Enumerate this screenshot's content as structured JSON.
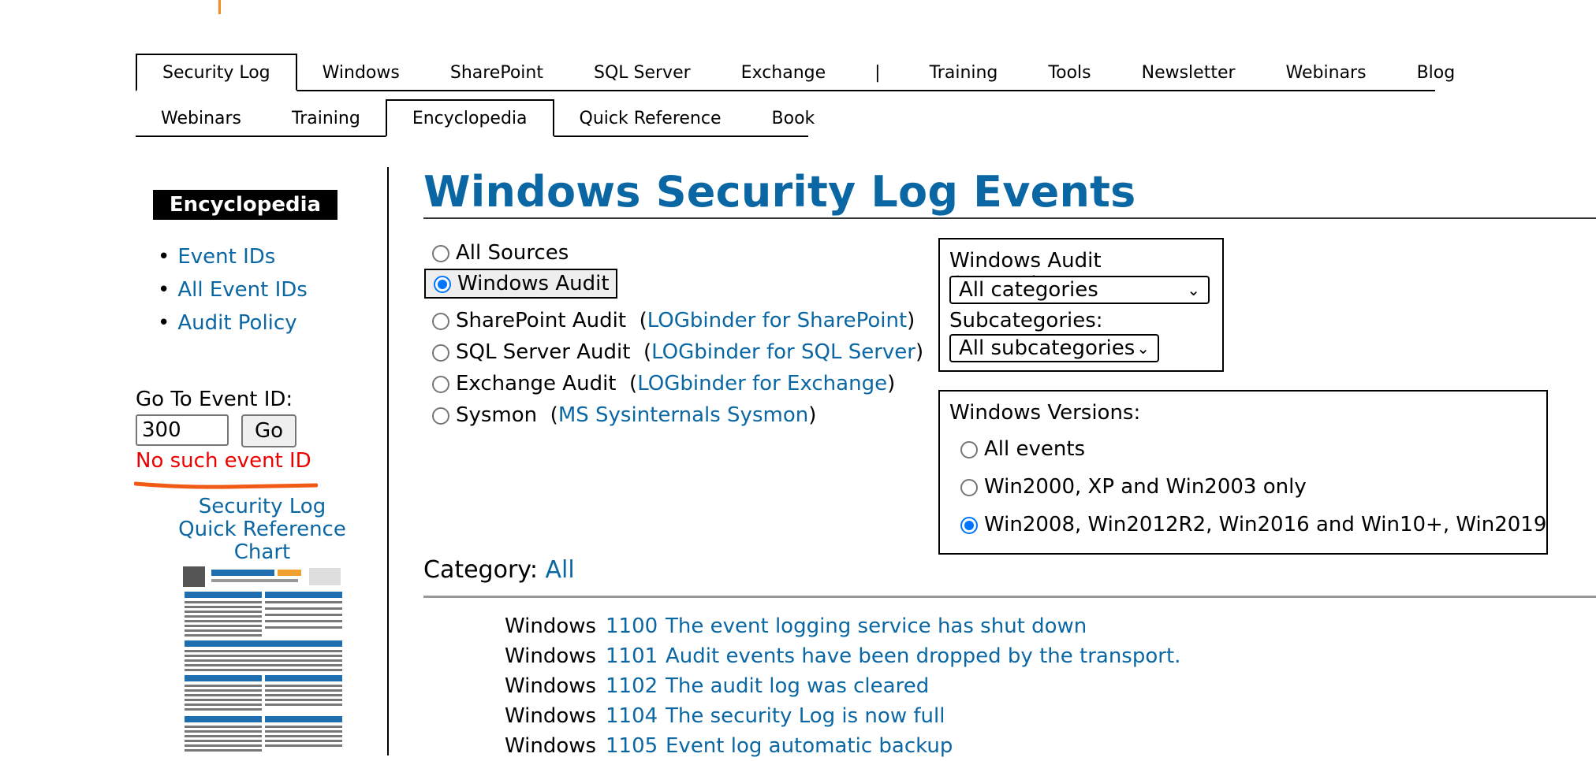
{
  "nav_primary": [
    "Security Log",
    "Windows",
    "SharePoint",
    "SQL Server",
    "Exchange",
    "|",
    "Training",
    "Tools",
    "Newsletter",
    "Webinars",
    "Blog"
  ],
  "nav_secondary": [
    "Webinars",
    "Training",
    "Encyclopedia",
    "Quick Reference",
    "Book"
  ],
  "sidebar": {
    "badge": "Encyclopedia",
    "links": [
      "Event IDs",
      "All Event IDs",
      "Audit Policy"
    ],
    "goto_label": "Go To Event ID:",
    "goto_value": "300",
    "go_button": "Go",
    "error": "No such event ID",
    "quickref": [
      "Security Log",
      "Quick Reference",
      "Chart"
    ]
  },
  "main": {
    "title": "Windows Security Log Events",
    "sources": [
      {
        "label": "All Sources",
        "link": "",
        "checked": false
      },
      {
        "label": "Windows Audit",
        "link": "",
        "checked": true
      },
      {
        "label": "SharePoint Audit",
        "link": "LOGbinder for SharePoint",
        "checked": false
      },
      {
        "label": "SQL Server Audit",
        "link": "LOGbinder for SQL Server",
        "checked": false
      },
      {
        "label": "Exchange Audit",
        "link": "LOGbinder for Exchange",
        "checked": false
      },
      {
        "label": "Sysmon",
        "link": "MS Sysinternals Sysmon",
        "checked": false
      }
    ],
    "categories_label": "Windows Audit Categories:",
    "categories_value": "All categories",
    "subcategories_label": "Subcategories:",
    "subcategories_value": "All subcategories",
    "versions_label": "Windows Versions:",
    "versions": [
      {
        "label": "All events",
        "checked": false
      },
      {
        "label": "Win2000, XP and Win2003 only",
        "checked": false
      },
      {
        "label": "Win2008, Win2012R2, Win2016 and Win10+, Win2019",
        "checked": true
      }
    ],
    "category_prefix": "Category:",
    "category_value": "All",
    "events": [
      {
        "source": "Windows",
        "id": "1100",
        "desc": "The event logging service has shut down"
      },
      {
        "source": "Windows",
        "id": "1101",
        "desc": "Audit events have been dropped by the transport."
      },
      {
        "source": "Windows",
        "id": "1102",
        "desc": "The audit log was cleared"
      },
      {
        "source": "Windows",
        "id": "1104",
        "desc": "The security Log is now full"
      },
      {
        "source": "Windows",
        "id": "1105",
        "desc": "Event log automatic backup"
      }
    ]
  }
}
